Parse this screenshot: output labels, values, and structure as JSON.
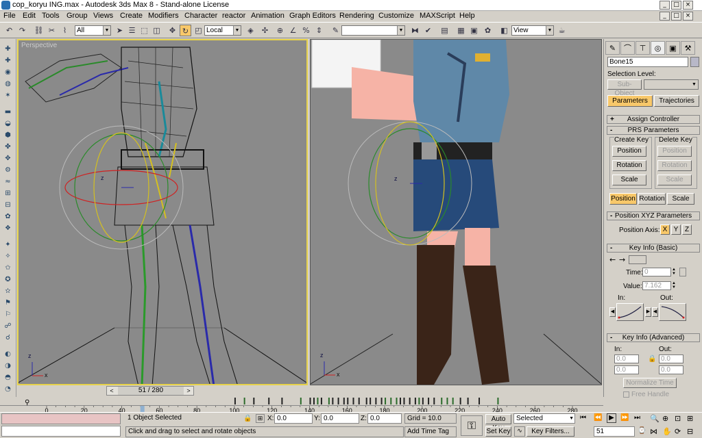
{
  "window": {
    "title": "cop_koryu ING.max - Autodesk 3ds Max 8  - Stand-alone License",
    "controls": [
      "_",
      "□",
      "×"
    ],
    "inner_controls": [
      "_",
      "□",
      "×"
    ]
  },
  "menu": [
    "File",
    "Edit",
    "Tools",
    "Group",
    "Views",
    "Create",
    "Modifiers",
    "Character",
    "reactor",
    "Animation",
    "Graph Editors",
    "Rendering",
    "Customize",
    "MAXScript",
    "Help"
  ],
  "toolbar": {
    "selection_filter": "All",
    "coord_system": "Local",
    "named_selection": "",
    "render_view": "View"
  },
  "viewports": {
    "left_label": "Perspective",
    "right_label": "",
    "axis_z": "z",
    "axis_x": "x"
  },
  "viewport_scroll": {
    "prev": "<",
    "value": "51 / 280",
    "next": ">"
  },
  "command_panel": {
    "object_name": "Bone15",
    "selection_level_label": "Selection Level:",
    "sub_object_label": "Sub-Object",
    "tab_parameters": "Parameters",
    "tab_trajectories": "Trajectories",
    "rollouts": {
      "assign_controller": "Assign Controller",
      "prs_parameters": "PRS Parameters",
      "position_xyz": "Position XYZ Parameters",
      "key_info_basic": "Key Info (Basic)",
      "key_info_advanced": "Key Info (Advanced)"
    },
    "create_key": {
      "label": "Create Key",
      "position": "Position",
      "rotation": "Rotation",
      "scale": "Scale"
    },
    "delete_key": {
      "label": "Delete Key",
      "position": "Position",
      "rotation": "Rotation",
      "scale": "Scale"
    },
    "prs_mode": {
      "position": "Position",
      "rotation": "Rotation",
      "scale": "Scale"
    },
    "position_axis": {
      "label": "Position Axis:",
      "x": "X",
      "y": "Y",
      "z": "Z"
    },
    "key_info_basic": {
      "time_label": "Time:",
      "time_value": "0",
      "value_label": "Value:",
      "value_value": "7.162",
      "in_label": "In:",
      "out_label": "Out:"
    },
    "key_info_advanced": {
      "in_label": "In:",
      "out_label": "Out:",
      "in_val1": "0.0",
      "in_val2": "0.0",
      "out_val1": "0.0",
      "out_val2": "0.0",
      "normalize_time": "Normalize Time",
      "free_handle": "Free Handle"
    }
  },
  "timeline": {
    "ticks": [
      "0",
      "20",
      "40",
      "60",
      "80",
      "100",
      "120",
      "140",
      "160",
      "180",
      "200",
      "220",
      "240",
      "260",
      "280"
    ],
    "current_frame": 51,
    "total_frames": 280
  },
  "status": {
    "selected_count": "1 Object Selected",
    "prompt": "Click and drag to select and rotate objects",
    "x_label": "X:",
    "x_value": "0.0",
    "y_label": "Y:",
    "y_value": "0.0",
    "z_label": "Z:",
    "z_value": "0.0",
    "grid": "Grid = 10.0",
    "add_time_tag": "Add Time Tag",
    "auto_key": "Auto Key",
    "set_key": "Set Key",
    "selected_dropdown": "Selected",
    "key_filters": "Key Filters...",
    "frame_field": "51"
  },
  "colors": {
    "active_viewport_border": "#e6d24a",
    "active_button": "#f8c86a",
    "viewport_bg": "#8a8a8a",
    "ui_bg": "#d4d0c8"
  }
}
